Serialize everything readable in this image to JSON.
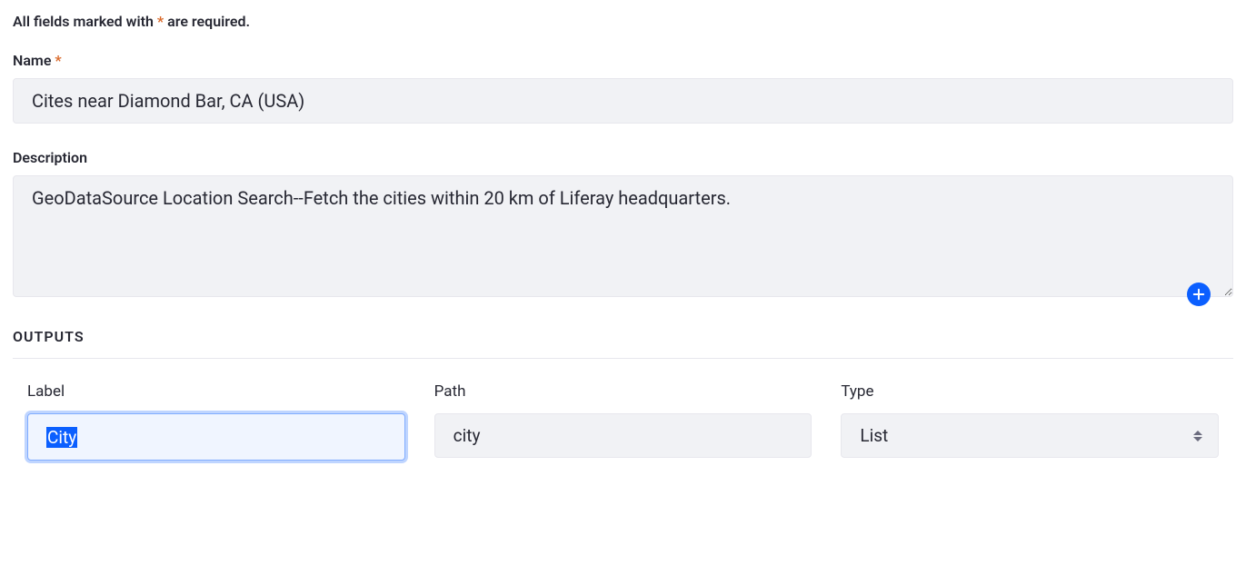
{
  "required_note_prefix": "All fields marked with",
  "required_note_star": "*",
  "required_note_suffix": "are required.",
  "name": {
    "label": "Name",
    "required_star": "*",
    "value": "Cites near Diamond Bar, CA (USA)"
  },
  "description": {
    "label": "Description",
    "value": "GeoDataSource Location Search--Fetch the cities within 20 km of Liferay headquarters."
  },
  "outputs": {
    "title": "OUTPUTS",
    "columns": {
      "label": "Label",
      "path": "Path",
      "type": "Type"
    },
    "row": {
      "label_value": "City",
      "path_value": "city",
      "type_value": "List"
    }
  }
}
